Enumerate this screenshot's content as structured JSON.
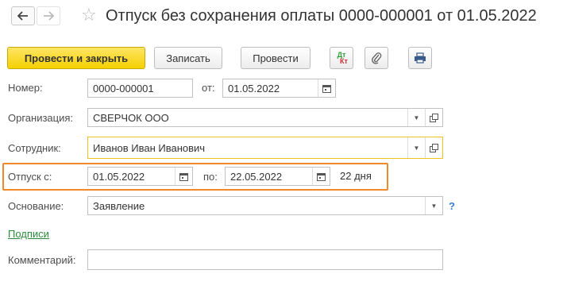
{
  "window": {
    "title": "Отпуск без сохранения оплаты 0000-000001 от 01.05.2022",
    "back_icon": "arrow-left-icon",
    "forward_icon": "arrow-right-icon",
    "favorite_icon": "star-icon"
  },
  "toolbar": {
    "post_and_close": "Провести и закрыть",
    "write": "Записать",
    "post": "Провести",
    "dt_label": "Дт",
    "kt_label": "Кт"
  },
  "form": {
    "number_label": "Номер:",
    "number_value": "0000-000001",
    "date_label": "от:",
    "date_value": "01.05.2022",
    "organization_label": "Организация:",
    "organization_value": "СВЕРЧОК ООО",
    "employee_label": "Сотрудник:",
    "employee_value": "Иванов Иван Иванович",
    "vacation_from_label": "Отпуск с:",
    "vacation_from_value": "01.05.2022",
    "vacation_to_label": "по:",
    "vacation_to_value": "22.05.2022",
    "days_text": "22 дня",
    "basis_label": "Основание:",
    "basis_value": "Заявление",
    "help_text": "?",
    "signatures_link": "Подписи",
    "comment_label": "Комментарий:",
    "comment_value": ""
  },
  "colors": {
    "primary_button": "#f5d000",
    "highlight_border": "#ef8a2a",
    "focus_border": "#f0c020",
    "link": "#2a8a3a"
  }
}
